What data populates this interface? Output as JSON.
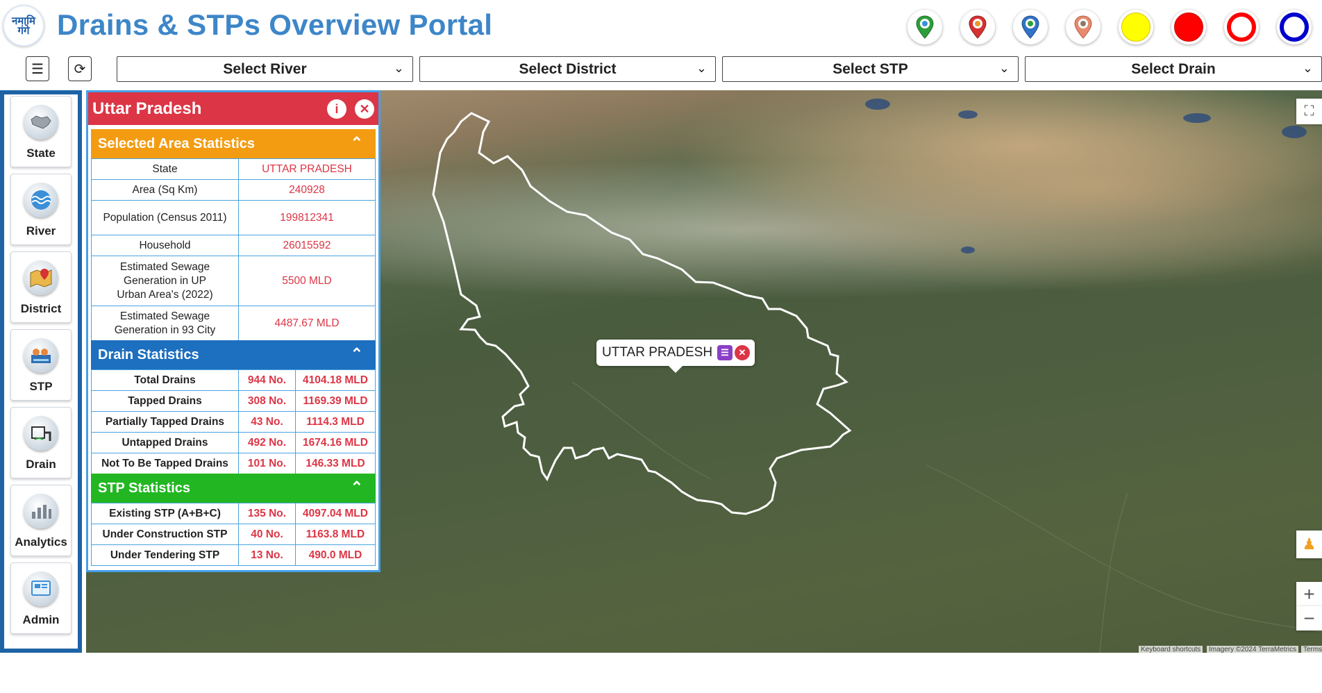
{
  "header": {
    "logo_text": "नमामि गंगे",
    "title": "Drains & STPs Overview Portal",
    "legend_pins": [
      {
        "name": "green-pin",
        "color": "#2e9e3a"
      },
      {
        "name": "red-pin",
        "color": "#d63232"
      },
      {
        "name": "blue-pin",
        "color": "#3273c8"
      },
      {
        "name": "salmon-pin",
        "color": "#e88a6e"
      }
    ],
    "legend_dots": [
      {
        "name": "yellow-dot",
        "color": "#ffff00"
      },
      {
        "name": "red-dot",
        "color": "#ff0000"
      },
      {
        "name": "red-ring",
        "color": "#ff0000"
      },
      {
        "name": "blue-ring",
        "color": "#0000cc"
      }
    ]
  },
  "filters": {
    "river": "Select River",
    "district": "Select District",
    "stp": "Select STP",
    "drain": "Select Drain"
  },
  "sidebar": {
    "items": [
      {
        "label": "State",
        "icon": "state-map-icon"
      },
      {
        "label": "River",
        "icon": "river-waves-icon"
      },
      {
        "label": "District",
        "icon": "district-map-icon"
      },
      {
        "label": "STP",
        "icon": "stp-plant-icon"
      },
      {
        "label": "Drain",
        "icon": "drain-icon"
      },
      {
        "label": "Analytics",
        "icon": "analytics-chart-icon"
      },
      {
        "label": "Admin",
        "icon": "admin-screen-icon"
      }
    ]
  },
  "panel": {
    "title": "Uttar Pradesh",
    "colors": {
      "header": "#dc3545",
      "area": "#f39c12",
      "drain": "#1d6fbf",
      "stp": "#22b722"
    },
    "area_stats": {
      "title": "Selected Area Statistics",
      "rows": [
        {
          "label": "State",
          "value": "UTTAR PRADESH"
        },
        {
          "label": "Area (Sq Km)",
          "value": "240928"
        },
        {
          "label": "Population (Census 2011)",
          "value": "199812341"
        },
        {
          "label": "Household",
          "value": "26015592"
        },
        {
          "label": "Estimated Sewage Generation in UP Urban Area's (2022)",
          "value": "5500 MLD"
        },
        {
          "label": "Estimated Sewage Generation in 93 City",
          "value": "4487.67 MLD"
        }
      ]
    },
    "drain_stats": {
      "title": "Drain Statistics",
      "rows": [
        {
          "label": "Total Drains",
          "count": "944 No.",
          "flow": "4104.18 MLD"
        },
        {
          "label": "Tapped Drains",
          "count": "308 No.",
          "flow": "1169.39 MLD"
        },
        {
          "label": "Partially Tapped Drains",
          "count": "43 No.",
          "flow": "1114.3 MLD"
        },
        {
          "label": "Untapped Drains",
          "count": "492 No.",
          "flow": "1674.16 MLD"
        },
        {
          "label": "Not To Be Tapped Drains",
          "count": "101 No.",
          "flow": "146.33 MLD"
        }
      ]
    },
    "stp_stats": {
      "title": "STP Statistics",
      "rows": [
        {
          "label": "Existing STP (A+B+C)",
          "count": "135 No.",
          "flow": "4097.04 MLD"
        },
        {
          "label": "Under Construction STP",
          "count": "40 No.",
          "flow": "1163.8 MLD"
        },
        {
          "label": "Under Tendering STP",
          "count": "13 No.",
          "flow": "490.0 MLD"
        }
      ]
    }
  },
  "map": {
    "popup_label": "UTTAR PRADESH",
    "attribution": {
      "shortcuts": "Keyboard shortcuts",
      "imagery": "Imagery ©2024 TerraMetrics",
      "terms": "Terms"
    }
  }
}
